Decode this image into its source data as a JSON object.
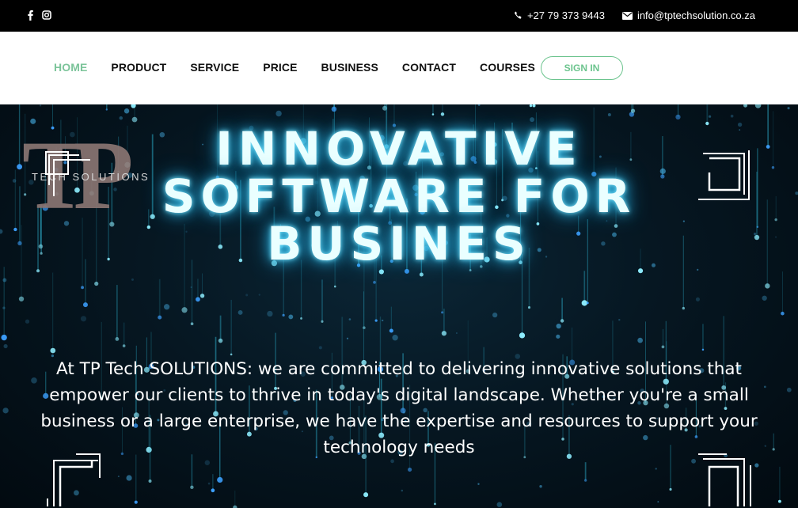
{
  "topbar": {
    "social": [
      {
        "icon": "facebook-icon"
      },
      {
        "icon": "instagram-icon"
      }
    ],
    "phone": "+27 79 373 9443",
    "email": "info@tptechsolution.co.za"
  },
  "nav": {
    "items": [
      "HOME",
      "PRODUCT",
      "SERVICE",
      "PRICE",
      "BUSINESS",
      "CONTACT",
      "COURSES"
    ],
    "active": "HOME",
    "signin": "SIGN IN"
  },
  "hero": {
    "logo_letters": "TP",
    "logo_sub": "TECH SOLUTIONS",
    "headline": [
      "INNOVATIVE",
      "SOFTWARE FOR",
      "BUSINES"
    ],
    "description": "At TP Tech SOLUTIONS: we are committed to delivering innovative solutions that empower our clients to thrive in today's digital landscape. Whether you're a small business or a large enterprise, we have the expertise and resources to support your technology needs"
  },
  "colors": {
    "accent": "#6cc48e",
    "glow": "#2ab6e6"
  }
}
